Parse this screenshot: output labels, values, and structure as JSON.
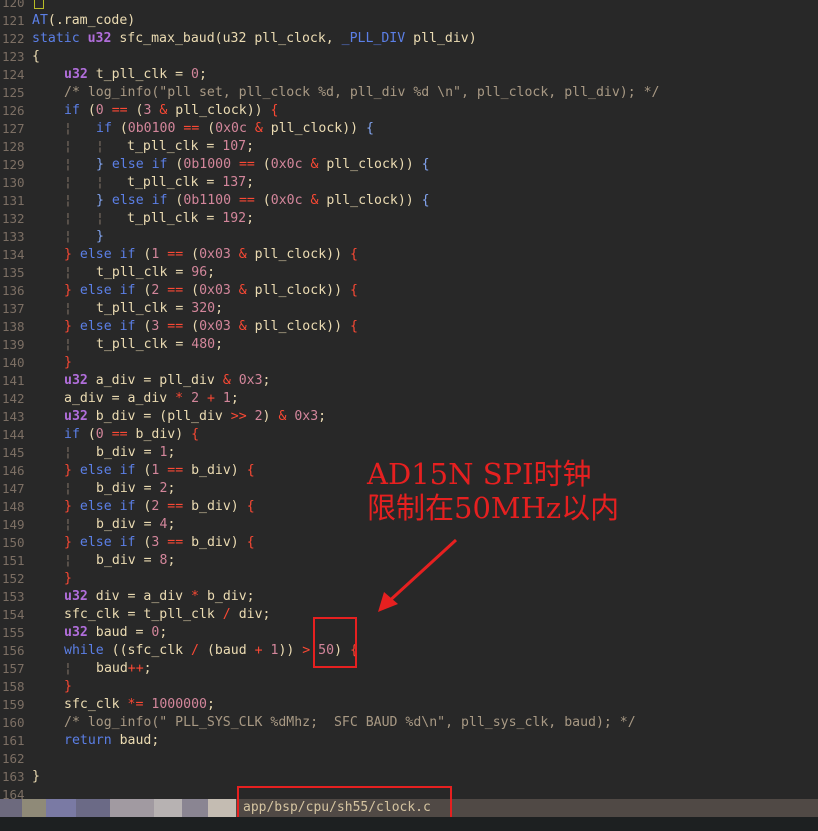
{
  "editor": {
    "lines": {
      "l120": "120",
      "l121": "121",
      "l122": "122",
      "l123": "123",
      "l124": "124",
      "l125": "125",
      "l126": "126",
      "l127": "127",
      "l128": "128",
      "l129": "129",
      "l130": "130",
      "l131": "131",
      "l132": "132",
      "l133": "133",
      "l134": "134",
      "l135": "135",
      "l136": "136",
      "l137": "137",
      "l138": "138",
      "l139": "139",
      "l140": "140",
      "l141": "141",
      "l142": "142",
      "l143": "143",
      "l144": "144",
      "l145": "145",
      "l146": "146",
      "l147": "147",
      "l148": "148",
      "l149": "149",
      "l150": "150",
      "l151": "151",
      "l152": "152",
      "l153": "153",
      "l154": "154",
      "l155": "155",
      "l156": "156",
      "l157": "157",
      "l158": "158",
      "l159": "159",
      "l160": "160",
      "l161": "161",
      "l162": "162",
      "l163": "163",
      "l164": "164"
    },
    "comment_log_pll": "/* log_info(\"pll set, pll_clock %d, pll_div %d \\n\", pll_clock, pll_div); */",
    "comment_log_clk": "/* log_info(\" PLL_SYS_CLK %dMhz;  SFC BAUD %d\\n\", pll_sys_clk, baud); */"
  },
  "annotation": {
    "line1": "AD15N SPI时钟",
    "line2": "限制在50MHz以内"
  },
  "status": {
    "file_path": "app/bsp/cpu/sh55/clock.c"
  },
  "colors": {
    "annotation": "#e62020",
    "background": "#282828",
    "statusbar": "#504945"
  }
}
